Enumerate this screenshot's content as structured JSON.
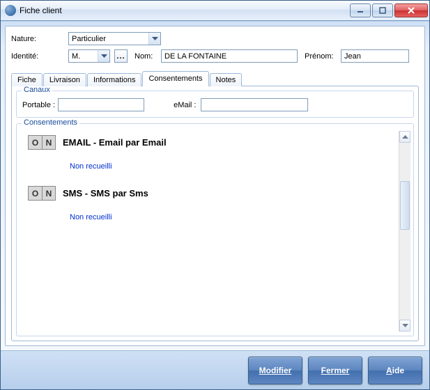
{
  "window": {
    "title": "Fiche client"
  },
  "form": {
    "nature_label": "Nature:",
    "nature_value": "Particulier",
    "identite_label": "Identité:",
    "identite_value": "M.",
    "nom_label": "Nom:",
    "nom_value": "DE LA FONTAINE",
    "prenom_label": "Prénom:",
    "prenom_value": "Jean",
    "ellipsis": "..."
  },
  "tabs": [
    {
      "label": "Fiche"
    },
    {
      "label": "Livraison"
    },
    {
      "label": "Informations"
    },
    {
      "label": "Consentements"
    },
    {
      "label": "Notes"
    }
  ],
  "canaux": {
    "legend": "Canaux",
    "portable_label": "Portable :",
    "portable_value": "",
    "email_label": "eMail :",
    "email_value": ""
  },
  "consentements": {
    "legend": "Consentements",
    "items": [
      {
        "o": "O",
        "n": "N",
        "title": "EMAIL - Email par Email",
        "status": "Non recueilli"
      },
      {
        "o": "O",
        "n": "N",
        "title": "SMS - SMS par Sms",
        "status": "Non recueilli"
      }
    ]
  },
  "buttons": {
    "modifier": "Modifier",
    "fermer": "Fermer",
    "aide_u": "A",
    "aide_rest": "ide"
  }
}
